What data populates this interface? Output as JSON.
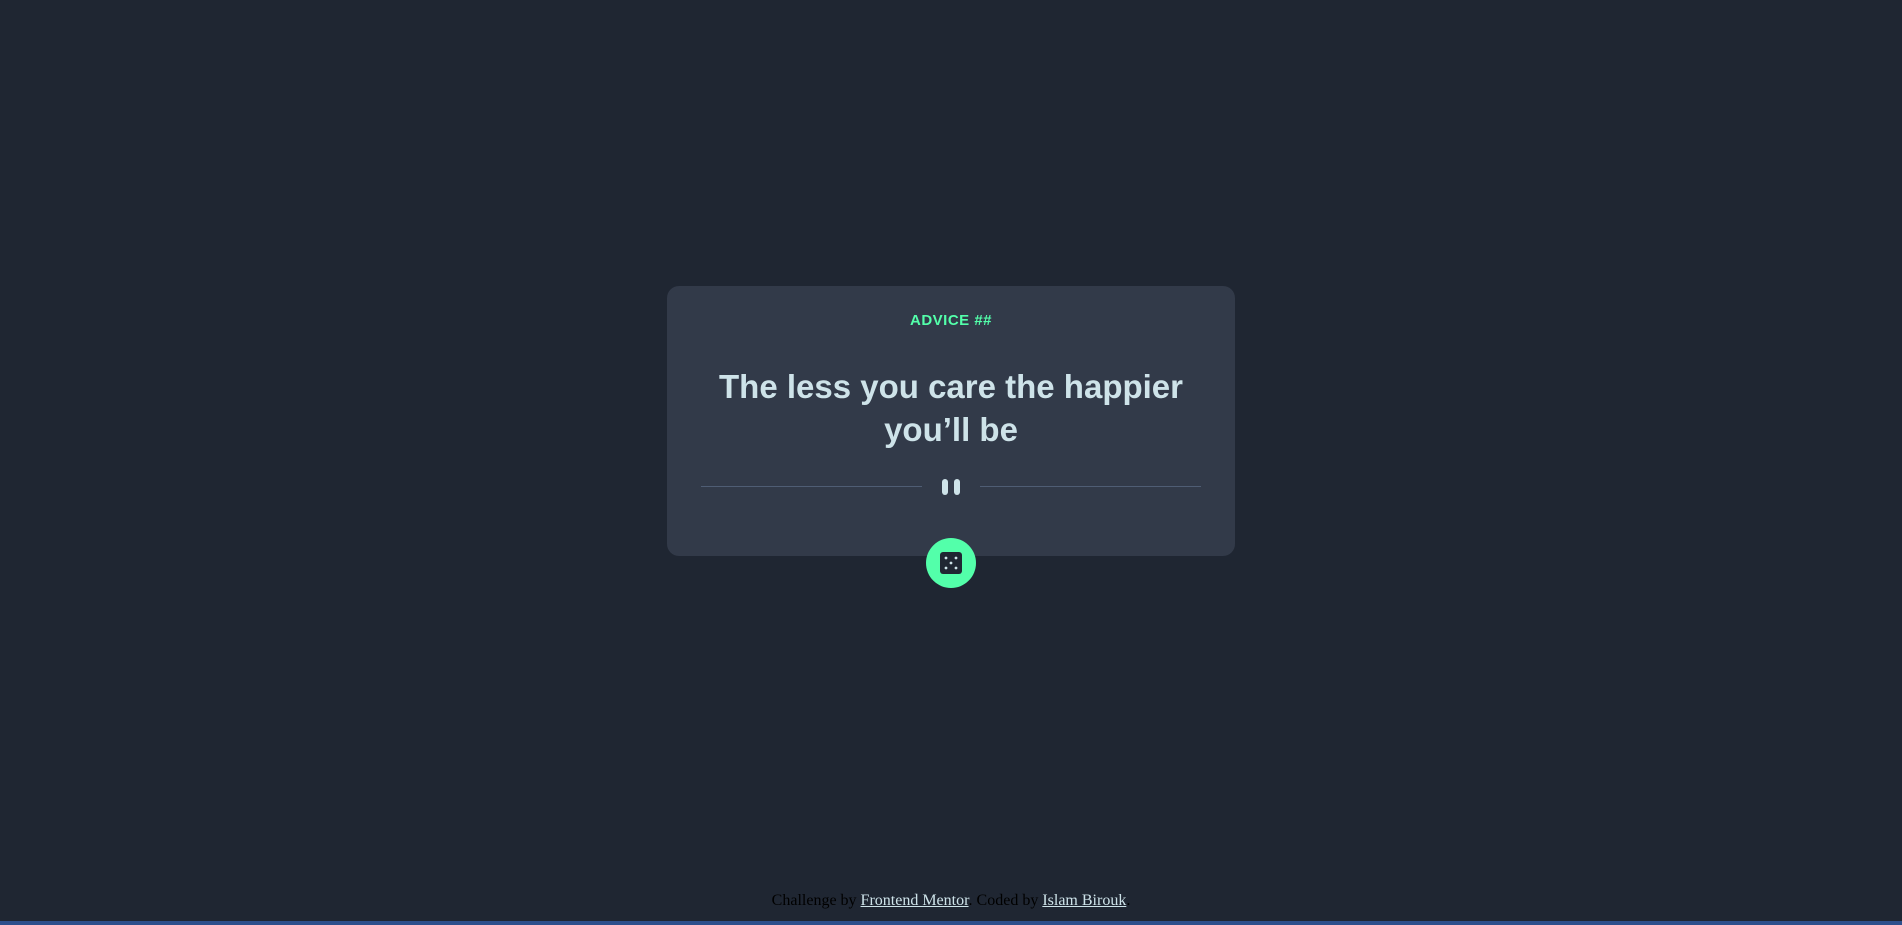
{
  "card": {
    "advice_label": "ADVICE ##",
    "quote": "The less you care the happier you’ll be"
  },
  "divider": {
    "icon": "pause-icon"
  },
  "dice_button": {
    "icon": "dice-icon"
  },
  "attribution": {
    "prefix": "Challenge by",
    "challenge_link": "Frontend Mentor",
    "middle": ". Coded by",
    "author_link": "Islam Birouk",
    "suffix": "."
  },
  "colors": {
    "background": "#1f2632",
    "card": "#323a49",
    "accent": "#53ffaa",
    "text": "#cee3e9",
    "divider": "#4f5d74"
  }
}
